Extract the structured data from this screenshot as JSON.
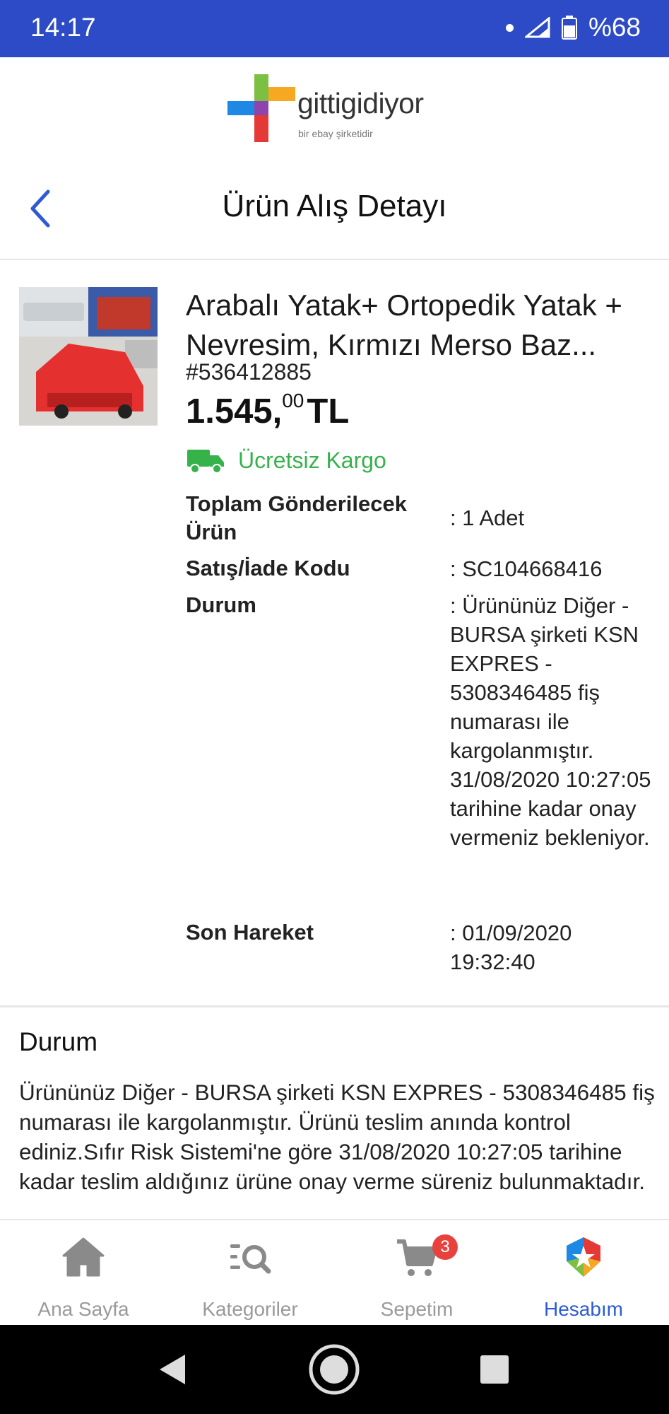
{
  "status_bar": {
    "time": "14:17",
    "battery": "%68"
  },
  "logo": {
    "name": "gittigidiyor",
    "tagline": "bir ebay şirketidir"
  },
  "header": {
    "title": "Ürün Alış Detayı"
  },
  "product": {
    "title": "Arabalı Yatak+ Ortopedik Yatak + Nevresim, Kırmızı Merso Baz...",
    "id": "#536412885",
    "price_main": "1.545,",
    "price_decimals": "00",
    "price_currency": "TL",
    "shipping": "Ücretsiz Kargo",
    "details": {
      "total_label": "Toplam Gönderilecek Ürün",
      "total_value": ": 1 Adet",
      "code_label": "Satış/İade Kodu",
      "code_value": ": SC104668416",
      "status_label": "Durum",
      "status_value": ": Ürününüz Diğer - BURSA şirketi KSN EXPRES - 5308346485 fiş numarası ile kargolanmıştır. 31/08/2020 10:27:05 tarihine kadar onay vermeniz bekleniyor.",
      "last_label": "Son Hareket",
      "last_value": ": 01/09/2020 19:32:40"
    }
  },
  "status_section": {
    "title": "Durum",
    "text": "Ürününüz Diğer - BURSA şirketi KSN EXPRES - 5308346485 fiş numarası ile kargolanmıştır. Ürünü teslim anında kontrol ediniz.Sıfır Risk Sistemi'ne göre 31/08/2020 10:27:05 tarihine kadar teslim aldığınız ürüne onay verme süreniz bulunmaktadır."
  },
  "tabs": [
    {
      "label": "Ana Sayfa",
      "icon": "home-icon"
    },
    {
      "label": "Kategoriler",
      "icon": "categories-search-icon"
    },
    {
      "label": "Sepetim",
      "icon": "cart-icon",
      "badge": "3"
    },
    {
      "label": "Hesabım",
      "icon": "account-badge-icon"
    }
  ],
  "colors": {
    "brand_blue": "#2d4bc6",
    "shipping_green": "#36b24a",
    "active_tab": "#2d5bd6",
    "badge_red": "#e8423f"
  }
}
